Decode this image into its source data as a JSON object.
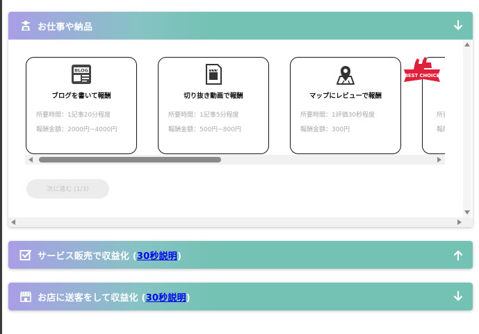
{
  "panels": {
    "work": {
      "title": "お仕事や納品",
      "icon": "worker-icon",
      "expanded": true,
      "cards": [
        {
          "icon": "blog-icon",
          "title": "ブログを書いて報酬",
          "time": "所要時間：1記事20分程度",
          "reward": "報酬金額：2000円~4000円"
        },
        {
          "icon": "video-clip-icon",
          "title": "切り抜き動画で報酬",
          "time": "所要時間：1記事5分程度",
          "reward": "報酬金額：500円~800円"
        },
        {
          "icon": "map-pin-icon",
          "title": "マップにレビューで報酬",
          "time": "所要時間：1評価30秒程度",
          "reward": "報酬金額：300円"
        },
        {
          "icon": "",
          "title": "",
          "time": "所要",
          "reward": "報酬"
        }
      ],
      "badge_text": "BEST CHOICE",
      "next_button": "次に進む (1/3)"
    },
    "service": {
      "title_prefix": "サービス販売で収益化 (",
      "link": "30秒説明",
      "title_suffix": ")",
      "icon": "checkbox-icon",
      "expanded": false
    },
    "store": {
      "title_prefix": "お店に送客をして収益化 (",
      "link": "30秒説明",
      "title_suffix": ")",
      "icon": "store-icon",
      "expanded": false
    }
  },
  "colors": {
    "header_start": "#a99ee6",
    "header_main": "#73c2b3",
    "badge_red": "#e0203a",
    "link": "#0000ee"
  }
}
